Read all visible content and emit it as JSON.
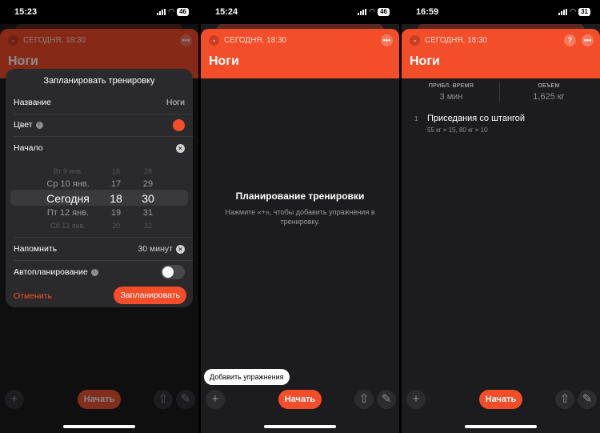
{
  "screens": [
    {
      "time": "15:23",
      "battery": "46",
      "date_label": "СЕГОДНЯ, 18:30",
      "title": "Ноги",
      "sheet": {
        "title": "Запланировать тренировку",
        "name_label": "Название",
        "name_value": "Ноги",
        "color_label": "Цвет",
        "start_label": "Начало",
        "picker": {
          "days": [
            "Вт 9 янв.",
            "Ср 10 янв.",
            "Сегодня",
            "Пт 12 янв.",
            "Сб 13 янв."
          ],
          "hours": [
            "16",
            "17",
            "18",
            "19",
            "20"
          ],
          "minutes": [
            "28",
            "29",
            "30",
            "31",
            "32"
          ]
        },
        "remind_label": "Напомнить",
        "remind_value": "30 минут",
        "autoplan_label": "Автопланирование",
        "cancel": "Отменить",
        "schedule": "Запланировать"
      },
      "start_button": "Начать"
    },
    {
      "time": "15:24",
      "battery": "46",
      "date_label": "СЕГОДНЯ, 18:30",
      "title": "Ноги",
      "empty_title": "Планирование тренировки",
      "empty_subtitle": "Нажмите «+», чтобы добавить упражнения в тренировку.",
      "tooltip": "Добавить упражнения",
      "start_button": "Начать"
    },
    {
      "time": "16:59",
      "battery": "31",
      "date_label": "СЕГОДНЯ, 18:30",
      "title": "Ноги",
      "stats": [
        {
          "label": "ПРИБЛ. ВРЕМЯ",
          "value": "3 мин"
        },
        {
          "label": "ОБЪЕМ",
          "value": "1,625 кг"
        }
      ],
      "exercise": {
        "number": "1",
        "name": "Приседания со штангой",
        "detail": "55 кг × 15, 80 кг × 10"
      },
      "start_button": "Начать"
    }
  ],
  "icons": {
    "plus": "+",
    "share": "⇧",
    "edit": "✎",
    "more": "•••",
    "help": "?",
    "chevron": "⌄",
    "clear": "×",
    "info": "i"
  },
  "colors": {
    "accent": "#f44d2a",
    "background": "#1c1c1e"
  }
}
